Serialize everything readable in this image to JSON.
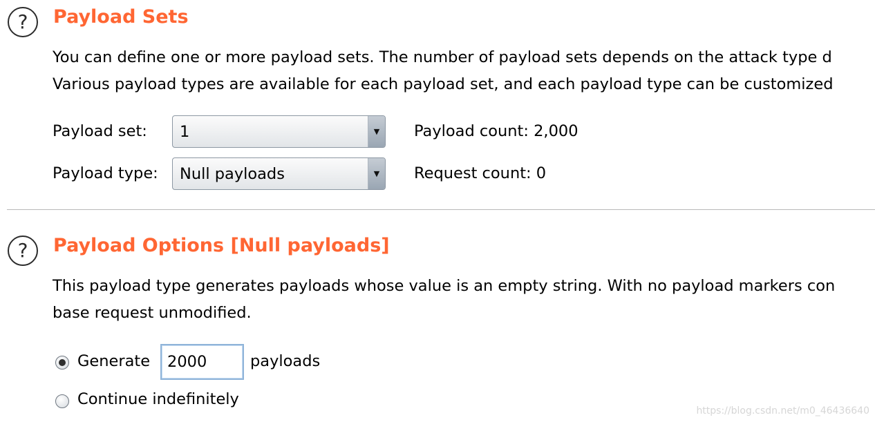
{
  "payload_sets": {
    "heading": "Payload Sets",
    "help_icon": "?",
    "description_line1": "You can define one or more payload sets. The number of payload sets depends on the attack type d",
    "description_line2": "Various payload types are available for each payload set, and each payload type can be customized",
    "set_label": "Payload set:",
    "set_value": "1",
    "type_label": "Payload type:",
    "type_value": "Null payloads",
    "payload_count": "Payload count: 2,000",
    "request_count": "Request count: 0",
    "dropdown_arrow": "▼"
  },
  "payload_options": {
    "heading": "Payload Options [Null payloads]",
    "help_icon": "?",
    "description_line1": "This payload type generates payloads whose value is an empty string. With no payload markers con",
    "description_line2": "base request unmodified.",
    "generate_label": "Generate",
    "generate_value": "2000",
    "payloads_suffix": "payloads",
    "continue_label": "Continue indefinitely",
    "selected_option": "Generate"
  },
  "watermark": "https://blog.csdn.net/m0_46436640",
  "colors": {
    "heading": "#ff6633",
    "divider": "#b9b9b9",
    "input_border": "#8fb4d9"
  }
}
